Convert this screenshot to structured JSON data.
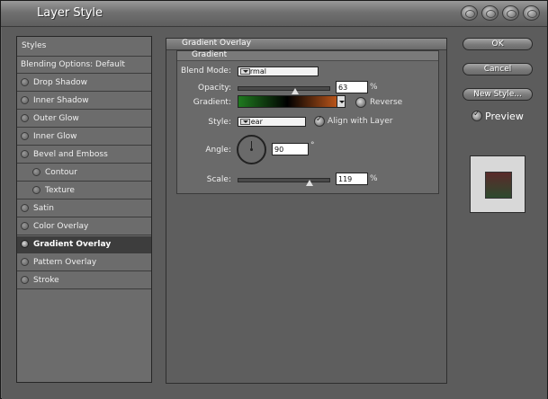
{
  "window": {
    "title": "Layer Style"
  },
  "sidebar": {
    "header": "Styles",
    "items": [
      {
        "label": "Blending Options: Default",
        "has_check": false,
        "indent": 0
      },
      {
        "label": "Drop Shadow",
        "has_check": true,
        "indent": 0
      },
      {
        "label": "Inner Shadow",
        "has_check": true,
        "indent": 0
      },
      {
        "label": "Outer Glow",
        "has_check": true,
        "indent": 0
      },
      {
        "label": "Inner Glow",
        "has_check": true,
        "indent": 0
      },
      {
        "label": "Bevel and Emboss",
        "has_check": true,
        "indent": 0
      },
      {
        "label": "Contour",
        "has_check": true,
        "indent": 1
      },
      {
        "label": "Texture",
        "has_check": true,
        "indent": 1
      },
      {
        "label": "Satin",
        "has_check": true,
        "indent": 0
      },
      {
        "label": "Color Overlay",
        "has_check": true,
        "indent": 0
      },
      {
        "label": "Gradient Overlay",
        "has_check": true,
        "indent": 0,
        "selected": true
      },
      {
        "label": "Pattern Overlay",
        "has_check": true,
        "indent": 0
      },
      {
        "label": "Stroke",
        "has_check": true,
        "indent": 0
      }
    ]
  },
  "panel": {
    "title": "Gradient Overlay",
    "group_title": "Gradient",
    "blend_mode": {
      "label": "Blend Mode:",
      "value": "Normal"
    },
    "opacity": {
      "label": "Opacity:",
      "value": "63",
      "unit": "%",
      "level": 0.63
    },
    "gradient": {
      "label": "Gradient:",
      "reverse_label": "Reverse",
      "colors": [
        "#1f7a1f",
        "#000000",
        "#b8541a"
      ]
    },
    "style": {
      "label": "Style:",
      "value": "Linear",
      "align_label": "Align with Layer",
      "align_checked": true
    },
    "angle": {
      "label": "Angle:",
      "value": "90",
      "unit": "°"
    },
    "scale": {
      "label": "Scale:",
      "value": "119",
      "unit": "%",
      "level": 0.79
    }
  },
  "buttons": {
    "ok": "OK",
    "cancel": "Cancel",
    "new_style": "New Style..."
  },
  "preview": {
    "label": "Preview",
    "checked": true
  }
}
